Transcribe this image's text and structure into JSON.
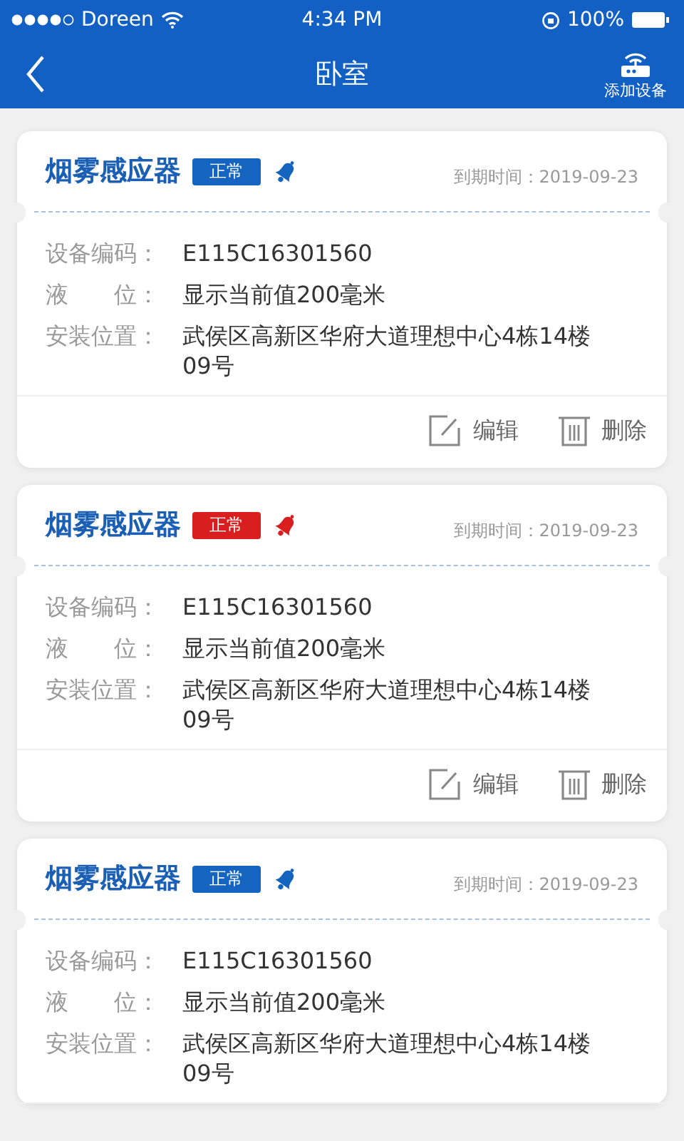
{
  "status_bar": {
    "carrier": "Doreen",
    "time": "4:34 PM",
    "battery": "100%"
  },
  "nav": {
    "title": "卧室",
    "action": "添加设备"
  },
  "cards": [
    {
      "name": "烟雾感应器",
      "status": "正常",
      "color": "#1565c0",
      "expiry": "到期时间：2019-09-23",
      "fields": [
        {
          "label": "设备编码：",
          "value": "E115C16301560"
        },
        {
          "label": "液　　位：",
          "value": "显示当前值200毫米"
        },
        {
          "label": "安装位置：",
          "value": "武侯区高新区华府大道理想中心4栋14楼09号"
        }
      ],
      "actions": [
        "编辑",
        "删除"
      ]
    },
    {
      "name": "烟雾感应器",
      "status": "正常",
      "color": "#d81e1e",
      "expiry": "到期时间：2019-09-23",
      "fields": [
        {
          "label": "设备编码：",
          "value": "E115C16301560"
        },
        {
          "label": "液　　位：",
          "value": "显示当前值200毫米"
        },
        {
          "label": "安装位置：",
          "value": "武侯区高新区华府大道理想中心4栋14楼09号"
        }
      ],
      "actions": [
        "编辑",
        "删除"
      ]
    },
    {
      "name": "烟雾感应器",
      "status": "正常",
      "color": "#1565c0",
      "expiry": "到期时间：2019-09-23",
      "fields": [
        {
          "label": "设备编码：",
          "value": "E115C16301560"
        },
        {
          "label": "液　　位：",
          "value": "显示当前值200毫米"
        },
        {
          "label": "安装位置：",
          "value": "武侯区高新区华府大道理想中心4栋14楼09号"
        }
      ]
    }
  ]
}
